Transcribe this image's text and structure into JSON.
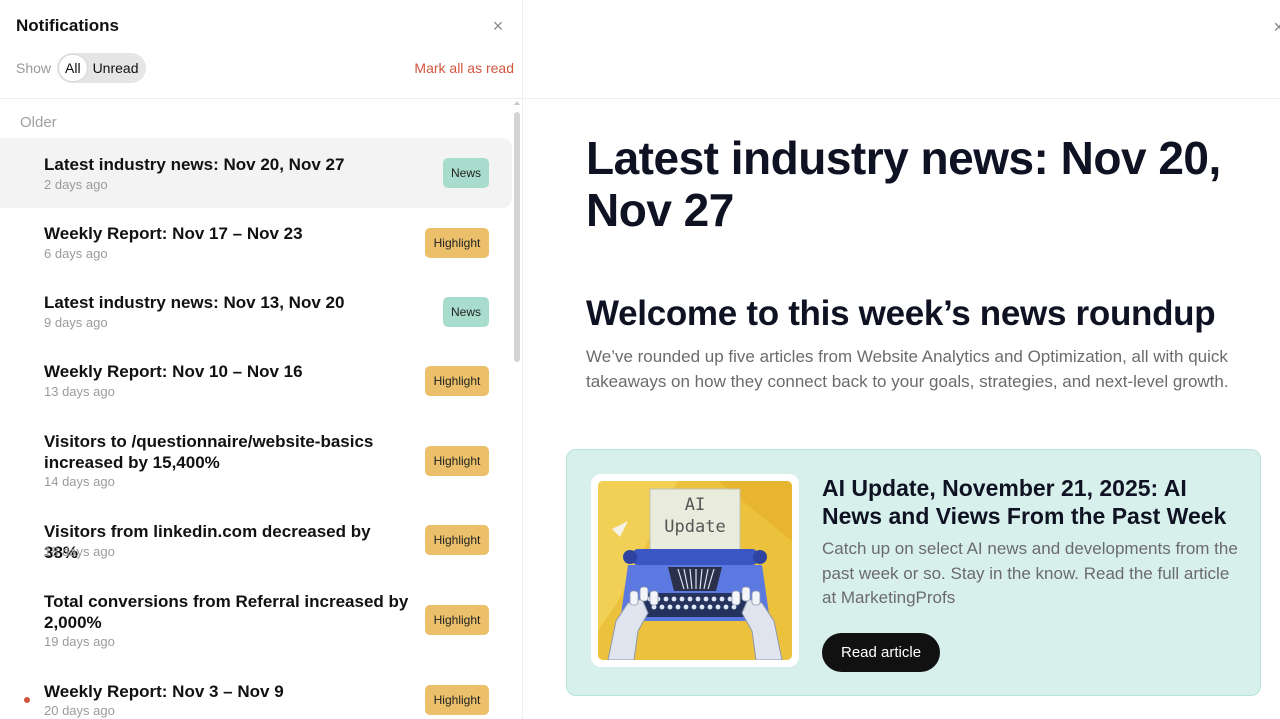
{
  "panel": {
    "title": "Notifications",
    "close_icon": "×",
    "show_label": "Show",
    "filter_all": "All",
    "filter_unread": "Unread",
    "mark_all": "Mark all as read",
    "section": "Older"
  },
  "notifications": [
    {
      "title": "Latest industry news: Nov 20, Nov 27",
      "time": "2 days ago",
      "badge": "News",
      "badge_type": "news",
      "selected": true,
      "unread": false
    },
    {
      "title": "Weekly Report: Nov 17 – Nov 23",
      "time": "6 days ago",
      "badge": "Highlight",
      "badge_type": "highlight",
      "selected": false,
      "unread": false
    },
    {
      "title": "Latest industry news: Nov 13, Nov 20",
      "time": "9 days ago",
      "badge": "News",
      "badge_type": "news",
      "selected": false,
      "unread": false
    },
    {
      "title": "Weekly Report: Nov 10 – Nov 16",
      "time": "13 days ago",
      "badge": "Highlight",
      "badge_type": "highlight",
      "selected": false,
      "unread": false
    },
    {
      "title": "Visitors to /questionnaire/website-basics increased by 15,400%",
      "time": "14 days ago",
      "badge": "Highlight",
      "badge_type": "highlight",
      "selected": false,
      "unread": false
    },
    {
      "title": "Visitors from linkedin.com decreased by 38%",
      "time": "18 days ago",
      "badge": "Highlight",
      "badge_type": "highlight",
      "selected": false,
      "unread": false
    },
    {
      "title": "Total conversions from Referral increased by 2,000%",
      "time": "19 days ago",
      "badge": "Highlight",
      "badge_type": "highlight",
      "selected": false,
      "unread": false
    },
    {
      "title": "Weekly Report: Nov 3 – Nov 9",
      "time": "20 days ago",
      "badge": "Highlight",
      "badge_type": "highlight",
      "selected": false,
      "unread": true
    }
  ],
  "article": {
    "title": "Latest industry news: Nov 20, Nov 27",
    "heading": "Welcome to this week’s news roundup",
    "intro": "We’ve rounded up five articles from Website Analytics and Optimization, all with quick takeaways on how they connect back to your goals, strategies, and next-level growth.",
    "card": {
      "image_text_line1": "AI",
      "image_text_line2": "Update",
      "title": "AI Update, November 21, 2025: AI News and Views From the Past Week",
      "description": "Catch up on select AI news and developments from the past week or so. Stay in the know. Read the full article at MarketingProfs",
      "button": "Read article"
    }
  },
  "colors": {
    "accent_red": "#d3553e",
    "news_badge": "#a8dccd",
    "highlight_badge": "#ecc06a",
    "card_bg": "#d8f0ec"
  }
}
